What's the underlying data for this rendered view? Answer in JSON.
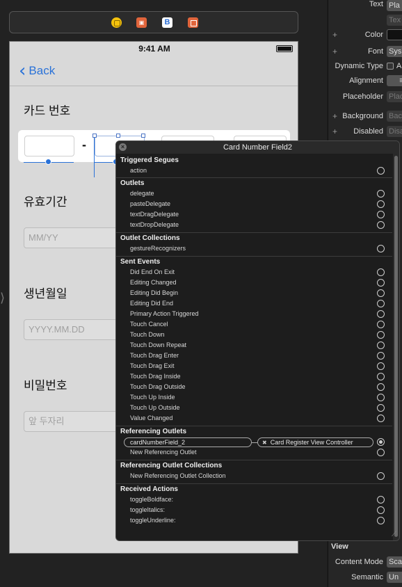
{
  "canvas": {
    "scene_icons": [
      "view-controller-icon",
      "cube-icon",
      "b-icon",
      "exit-icon"
    ],
    "scene_b_label": "B",
    "status_time": "9:41 AM",
    "back_label": "Back",
    "card_label": "카드 번호",
    "card_dash": "-",
    "expiry_label": "유효기간",
    "expiry_placeholder": "MM/YY",
    "birth_label": "생년월일",
    "birth_placeholder": "YYYY.MM.DD",
    "password_label": "비밀번호",
    "password_placeholder": "앞 두자리"
  },
  "inspector": {
    "text_label": "Text",
    "text_value": "Pla",
    "text_field_value": "Tex",
    "color_label": "Color",
    "font_label": "Font",
    "font_value": "Sys",
    "dynamic_type_label": "Dynamic Type",
    "dynamic_type_value": "A",
    "alignment_label": "Alignment",
    "placeholder_label": "Placeholder",
    "placeholder_value": "Plac",
    "background_label": "Background",
    "background_value": "Bac",
    "disabled_label": "Disabled",
    "disabled_value": "Disa",
    "view_section": "View",
    "content_mode_label": "Content Mode",
    "content_mode_value": "Sca",
    "semantic_label": "Semantic",
    "semantic_value": "Un"
  },
  "popover": {
    "title": "Card Number Field2",
    "sections": {
      "triggered_segues": "Triggered Segues",
      "outlets": "Outlets",
      "outlet_collections": "Outlet Collections",
      "sent_events": "Sent Events",
      "referencing_outlets": "Referencing Outlets",
      "referencing_outlet_collections": "Referencing Outlet Collections",
      "received_actions": "Received Actions"
    },
    "triggered_segues": [
      "action"
    ],
    "outlets": [
      "delegate",
      "pasteDelegate",
      "textDragDelegate",
      "textDropDelegate"
    ],
    "outlet_collections": [
      "gestureRecognizers"
    ],
    "sent_events": [
      "Did End On Exit",
      "Editing Changed",
      "Editing Did Begin",
      "Editing Did End",
      "Primary Action Triggered",
      "Touch Cancel",
      "Touch Down",
      "Touch Down Repeat",
      "Touch Drag Enter",
      "Touch Drag Exit",
      "Touch Drag Inside",
      "Touch Drag Outside",
      "Touch Up Inside",
      "Touch Up Outside",
      "Value Changed"
    ],
    "referencing_outlet": "cardNumberField_2",
    "referencing_target": "Card Register View Controller",
    "new_referencing_outlet": "New Referencing Outlet",
    "new_referencing_outlet_collection": "New Referencing Outlet Collection",
    "received_actions": [
      "toggleBoldface:",
      "toggleItalics:",
      "toggleUnderline:"
    ]
  }
}
